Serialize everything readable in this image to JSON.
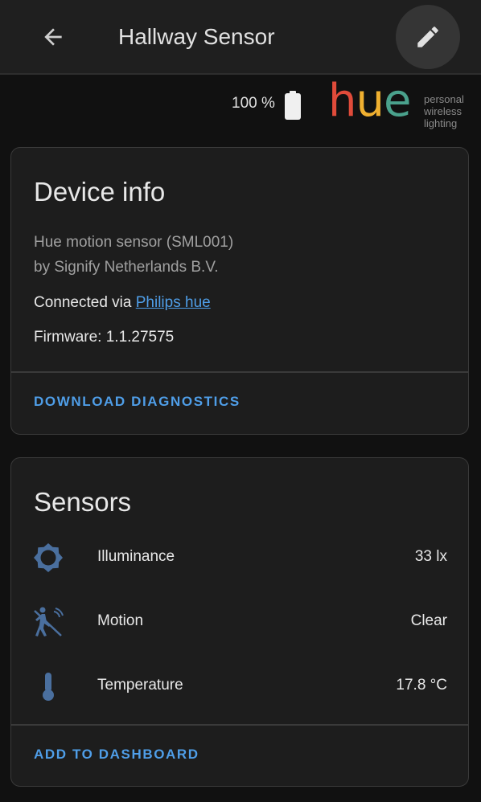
{
  "header": {
    "title": "Hallway Sensor",
    "back_icon": "arrow-left-icon",
    "edit_icon": "pencil-icon"
  },
  "status": {
    "battery_text": "100 %",
    "battery_icon": "battery-full-icon"
  },
  "logo": {
    "word_h": "h",
    "word_u": "u",
    "word_e": "e",
    "tagline_1": "personal",
    "tagline_2": "wireless",
    "tagline_3": "lighting"
  },
  "device_info": {
    "title": "Device info",
    "model": "Hue motion sensor (SML001)",
    "manufacturer": "by Signify Netherlands B.V.",
    "connected_prefix": "Connected via ",
    "connected_link": "Philips hue",
    "firmware": "Firmware: 1.1.27575",
    "action": "Download diagnostics"
  },
  "sensors": {
    "title": "Sensors",
    "items": [
      {
        "label": "Illuminance",
        "value": "33 lx",
        "icon": "brightness-icon"
      },
      {
        "label": "Motion",
        "value": "Clear",
        "icon": "motion-sensor-icon"
      },
      {
        "label": "Temperature",
        "value": "17.8 °C",
        "icon": "thermometer-icon"
      }
    ],
    "action": "Add to dashboard"
  },
  "colors": {
    "accent": "#4f9ee8",
    "icon": "#4a6f9e",
    "background": "#111111",
    "card": "#1d1d1d"
  }
}
